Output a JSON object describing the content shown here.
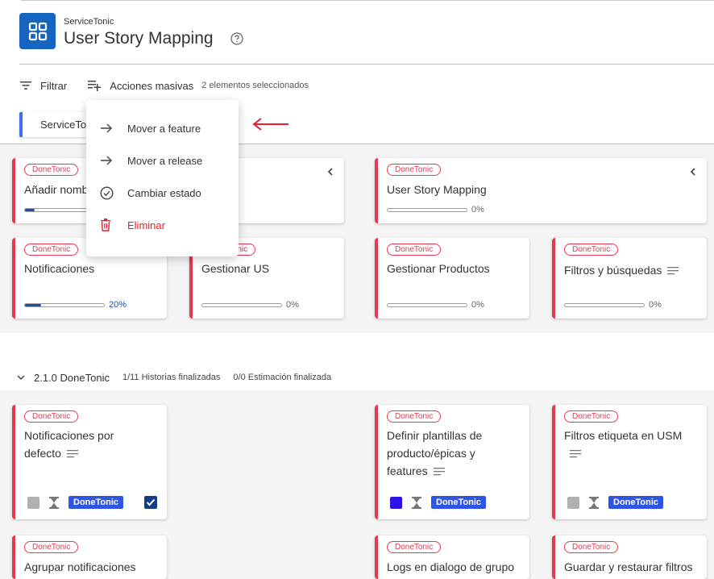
{
  "header": {
    "app_name": "ServiceTonic",
    "title": "User Story Mapping",
    "logo_icon": "grid-icon",
    "help_icon": "help-circle-icon"
  },
  "toolbar": {
    "filter_label": "Filtrar",
    "bulk_actions_label": "Acciones masivas",
    "selected_count": "2 elementos seleccionados"
  },
  "product_tab": {
    "label": "ServiceTonic"
  },
  "menu": {
    "items": [
      {
        "label": "Mover a feature",
        "icon": "arrow-right-icon"
      },
      {
        "label": "Mover a release",
        "icon": "arrow-right-icon"
      },
      {
        "label": "Cambiar estado",
        "icon": "check-circle-icon"
      },
      {
        "label": "Eliminar",
        "icon": "trash-icon"
      }
    ]
  },
  "epics": [
    {
      "badge": "DoneTonic",
      "title": "Añadir nombres",
      "progress": 12
    },
    {
      "badge": "DoneTonic",
      "title": "User Story Mapping",
      "progress": 0,
      "percent": "0%"
    }
  ],
  "features": [
    {
      "badge": "DoneTonic",
      "title": "Notificaciones",
      "progress": 20,
      "percent": "20%"
    },
    {
      "badge": "DoneTonic",
      "title": "Gestionar US",
      "progress": 0,
      "percent": "0%"
    },
    {
      "badge": "DoneTonic",
      "title": "Gestionar Productos",
      "progress": 0,
      "percent": "0%"
    },
    {
      "badge": "DoneTonic",
      "title": "Filtros y búsquedas",
      "progress": 0,
      "percent": "0%"
    }
  ],
  "release": {
    "name": "2.1.0 DoneTonic",
    "stories": "1/11 Historias finalizadas",
    "estimation": "0/0 Estimación finalizada"
  },
  "stories": [
    {
      "badge": "DoneTonic",
      "title_line1": "Notificaciones por",
      "title_line2": "defecto",
      "team": "DoneTonic",
      "color": "#b0b0b0",
      "checked": true
    },
    {
      "badge": "DoneTonic",
      "title_line1": "Definir plantillas de",
      "title_line2": "producto/épicas y",
      "title_line3": "features",
      "team": "DoneTonic",
      "color": "#2b13e8"
    },
    {
      "badge": "DoneTonic",
      "title_line1": "Filtros etiqueta en USM",
      "team": "DoneTonic",
      "color": "#b0b0b0"
    },
    {
      "badge": "DoneTonic",
      "title_line1": "Agrupar notificaciones"
    },
    {
      "badge": "DoneTonic",
      "title_line1": "Logs en dialogo de grupo"
    },
    {
      "badge": "DoneTonic",
      "title_line1": "Guardar y restaurar filtros"
    }
  ],
  "colors": {
    "accent": "#1565c0",
    "card_border": "#e53950",
    "team_chip": "#2f55e4",
    "danger": "#e5202e"
  }
}
